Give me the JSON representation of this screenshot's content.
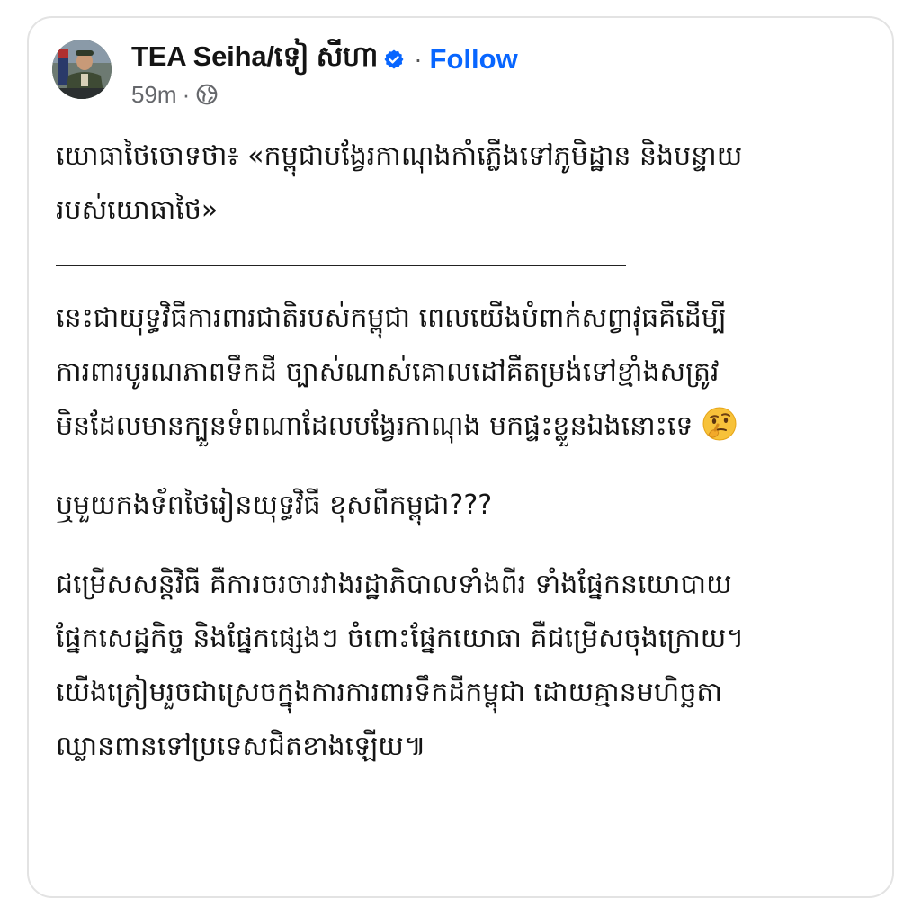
{
  "post": {
    "author_name": "TEA Seiha/ទៀ សីហា",
    "follow_label": "Follow",
    "timestamp": "59m",
    "separator": "·",
    "audience_icon": "globe-icon",
    "verified_icon": "verified-badge-icon",
    "colors": {
      "link": "#0866ff",
      "verified": "#0866ff",
      "meta": "#65676b"
    }
  },
  "content": {
    "p1_line1": "យោធាថៃចោទថា៖ «កម្ពុជាបង្វែរកាណុងកាំភ្លើងទៅភូមិដ្ឋាន និងបន្ទាយ",
    "p1_line2": "របស់យោធាថៃ»",
    "p2_line1": "នេះជាយុទ្ធវិធីការពារជាតិរបស់កម្ពុជា ពេលយើងបំពាក់សព្វាវុធគឺដើម្បី",
    "p2_line2": "ការពារបូរណភាពទឹកដី ច្បាស់ណាស់គោលដៅគឺតម្រង់ទៅខ្មាំងសត្រូវ",
    "p2_line3": "មិនដែលមានក្បួនទំពណាដែលបង្វែរកាណុង មកផ្ទះខ្លួនឯងនោះទេ",
    "p2_emoji": "thinking-face-emoji",
    "p3_line1": "ឬមួយកងទ័ពថៃរៀនយុទ្ធវិធី ខុសពីកម្ពុជា???",
    "p4_line1": "ជម្រើសសន្តិវិធី គឺការចរចារវាងរដ្ឋាភិបាលទាំងពីរ ទាំងផ្នែកនយោបាយ",
    "p4_line2": "ផ្នែកសេដ្ឋកិច្ច និងផ្នែកផ្សេងៗ ចំពោះផ្នែកយោធា គឺជម្រើសចុងក្រោយ។",
    "p4_line3": "យើងត្រៀមរួចជាស្រេចក្នុងការការពារទឹកដីកម្ពុជា ដោយគ្មានមហិច្ឆតា",
    "p4_line4": "ឈ្លានពានទៅប្រទេសជិតខាងឡើយ៕"
  }
}
